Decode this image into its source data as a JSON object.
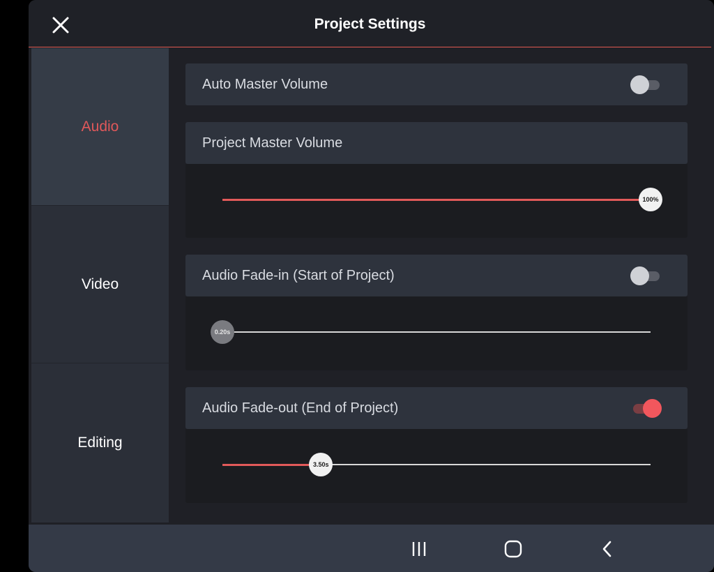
{
  "header": {
    "title": "Project Settings",
    "close_icon": "close-icon"
  },
  "sidebar": {
    "items": [
      {
        "label": "Audio",
        "active": true
      },
      {
        "label": "Video",
        "active": false
      },
      {
        "label": "Editing",
        "active": false
      }
    ]
  },
  "settings": {
    "auto_master_volume": {
      "label": "Auto Master Volume",
      "enabled": false
    },
    "project_master_volume": {
      "label": "Project Master Volume",
      "value_label": "100%",
      "value": 1.0
    },
    "fade_in": {
      "label": "Audio Fade-in (Start of Project)",
      "enabled": false,
      "value_label": "0.20s",
      "value": 0.0
    },
    "fade_out": {
      "label": "Audio Fade-out (End of Project)",
      "enabled": true,
      "value_label": "3.50s",
      "value": 0.23
    }
  },
  "navbar": {
    "icons": [
      "recent-apps-icon",
      "home-icon",
      "back-icon"
    ]
  },
  "colors": {
    "accent": "#e0585a",
    "toggle_on": "#f2575d",
    "background": "#1f2026",
    "sidebar": "#2b2f38",
    "sidebar_active": "#353c47",
    "card": "#2e333d"
  }
}
